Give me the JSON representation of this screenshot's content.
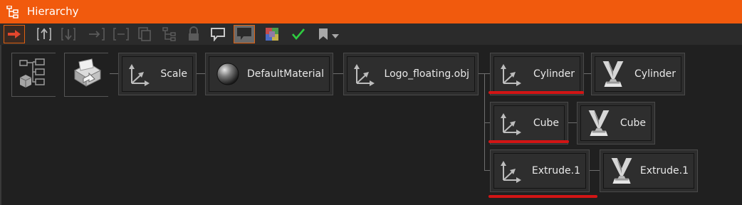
{
  "window": {
    "title": "Hierarchy"
  },
  "toolbar": {
    "items": [
      {
        "name": "go-to-selection-arrow-icon",
        "state": "selected"
      },
      {
        "name": "move-up-icon",
        "state": "normal"
      },
      {
        "name": "move-down-icon",
        "state": "disabled"
      },
      {
        "name": "indent-icon",
        "state": "disabled"
      },
      {
        "name": "group-icon",
        "state": "disabled"
      },
      {
        "name": "copy-icon",
        "state": "disabled"
      },
      {
        "name": "tree-icon",
        "state": "disabled"
      },
      {
        "name": "lock-icon",
        "state": "disabled"
      },
      {
        "name": "comment-icon",
        "state": "normal"
      },
      {
        "name": "comment-toggle-icon",
        "state": "selected"
      },
      {
        "name": "color-palette-icon",
        "state": "normal"
      },
      {
        "name": "check-icon",
        "state": "normal"
      },
      {
        "name": "bookmark-dropdown-icon",
        "state": "normal"
      }
    ],
    "accent": "#f15a0d",
    "check_color": "#2ecc40"
  },
  "nodes": {
    "scale": {
      "label": "Scale",
      "icon": "transform-axes-icon"
    },
    "material": {
      "label": "DefaultMaterial",
      "icon": "material-sphere-icon"
    },
    "logo": {
      "label": "Logo_floating.obj",
      "icon": "transform-axes-icon"
    },
    "cylinder_t": {
      "label": "Cylinder",
      "icon": "transform-axes-icon"
    },
    "cylinder_m": {
      "label": "Cylinder",
      "icon": "mesh-shape-icon"
    },
    "cube_t": {
      "label": "Cube",
      "icon": "transform-axes-icon"
    },
    "cube_m": {
      "label": "Cube",
      "icon": "mesh-shape-icon"
    },
    "extrude_t": {
      "label": "Extrude.1",
      "icon": "transform-axes-icon"
    },
    "extrude_m": {
      "label": "Extrude.1",
      "icon": "mesh-shape-icon"
    }
  },
  "annotations": {
    "underline_color": "#d21515"
  }
}
